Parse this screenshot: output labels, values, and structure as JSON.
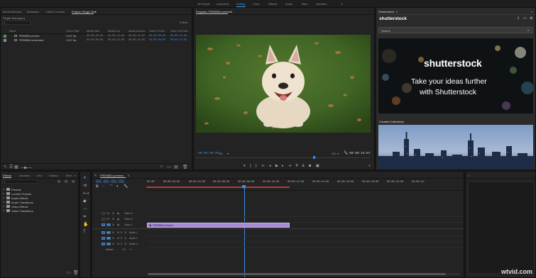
{
  "workspaces": [
    "All Panels",
    "Assembly",
    "Editing",
    "Color",
    "Effects",
    "Audio",
    "Titles",
    "Libraries"
  ],
  "active_workspace": "Editing",
  "project_panel": {
    "tabs": [
      "Media Browser",
      "Metadata",
      "Effect Controls",
      "Project: Plugin Test"
    ],
    "active_tab": "Project: Plugin Test",
    "project_file": "Plugin Test.prproj",
    "item_count": "2 Items",
    "columns": [
      "Name",
      "Frame Rate",
      "Media Start",
      "Media End",
      "Media Duration",
      "Video In Point",
      "Video Out Point"
    ],
    "rows": [
      {
        "name": "FRENBDI-preview",
        "color": "#3aa852",
        "frame_rate": "24.87 fps",
        "media_start": "00:00:00:00",
        "media_end": "00:00:15:06",
        "media_duration": "00:00:15:07",
        "video_in": "00:00:00:00",
        "video_out": "00:00:15:06"
      },
      {
        "name": "FRENBDI-hd-licensed",
        "color": "#9a7fd1",
        "frame_rate": "24.87 fps",
        "media_start": "00:00:00:00",
        "media_end": "00:00:15:06",
        "media_duration": "00:00:15:05",
        "video_in": "00:00:00:00",
        "video_out": "00:00:15:06"
      }
    ]
  },
  "program_monitor": {
    "title": "Program: FRENBDI-preview",
    "timecode": "00:00:06:09",
    "fit": "Fit",
    "quality": "1/2",
    "duration": "00:00:15:07"
  },
  "shutterstock_panel": {
    "tab_title": "Shutterstock",
    "logo": "shutterstock",
    "search_placeholder": "Search",
    "banner_logo": "shutterstock",
    "banner_tagline_1": "Take your ideas further",
    "banner_tagline_2": "with Shutterstock",
    "collections_label": "Curated Collections"
  },
  "effects_panel": {
    "tabs": [
      "Effects",
      "Libraries",
      "Info",
      "History",
      "Med"
    ],
    "active_tab": "Effects",
    "folders": [
      "Presets",
      "Lumetri Presets",
      "Audio Effects",
      "Audio Transitions",
      "Video Effects",
      "Video Transitions"
    ]
  },
  "timeline": {
    "tab_title": "FRENBDI-preview",
    "timecode": "00:00:06:09",
    "ruler_labels": [
      "00:00",
      "00:00:02:00",
      "00:00:04:00",
      "00:00:06:00",
      "00:00:08:00",
      "00:00:10:00",
      "00:00:12:00",
      "00:00:14:00",
      "00:00:16:00",
      "00:00:18:00",
      "00:00:20:00",
      "00:00:22:"
    ],
    "video_tracks": [
      "Video 3",
      "Video 2",
      "Video 1"
    ],
    "video_track_ids": [
      "V3",
      "V2",
      "V1"
    ],
    "audio_tracks": [
      "Audio 1",
      "Audio 2",
      "Audio 3"
    ],
    "audio_track_ids": [
      "A1",
      "A2",
      "A3"
    ],
    "master_label": "Master",
    "master_value": "0.0",
    "clip_label": "FRENBDI-preview"
  },
  "watermark": "wtvid.com",
  "colors": {
    "accent": "#3fa1ec",
    "timecode_blue": "#3a8fe6",
    "clip_purple": "#a68ad4",
    "inout_red": "#b53a3a"
  }
}
